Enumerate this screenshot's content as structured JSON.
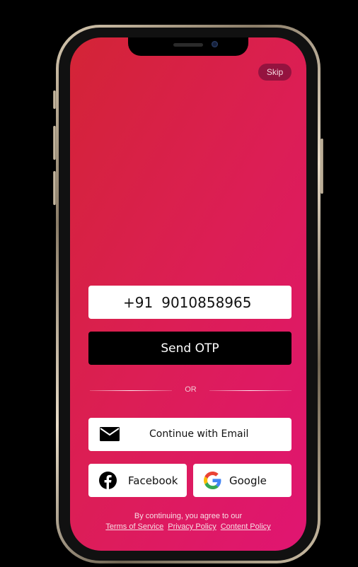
{
  "skip": {
    "label": "Skip"
  },
  "phone_input": {
    "country_code": "+91",
    "number": "9010858965"
  },
  "send_otp": {
    "label": "Send OTP"
  },
  "divider": {
    "label": "OR"
  },
  "email_button": {
    "label": "Continue with Email",
    "icon": "mail-icon"
  },
  "facebook_button": {
    "label": "Facebook",
    "icon": "facebook-icon"
  },
  "google_button": {
    "label": "Google",
    "icon": "google-icon"
  },
  "legal": {
    "intro": "By continuing, you agree to our",
    "links": [
      "Terms of Service",
      "Privacy Policy",
      "Content Policy"
    ]
  },
  "colors": {
    "gradient_start": "#d32436",
    "gradient_end": "#e01572",
    "skip_bg": "#94133f",
    "primary_button": "#000000",
    "facebook": "#000000"
  }
}
